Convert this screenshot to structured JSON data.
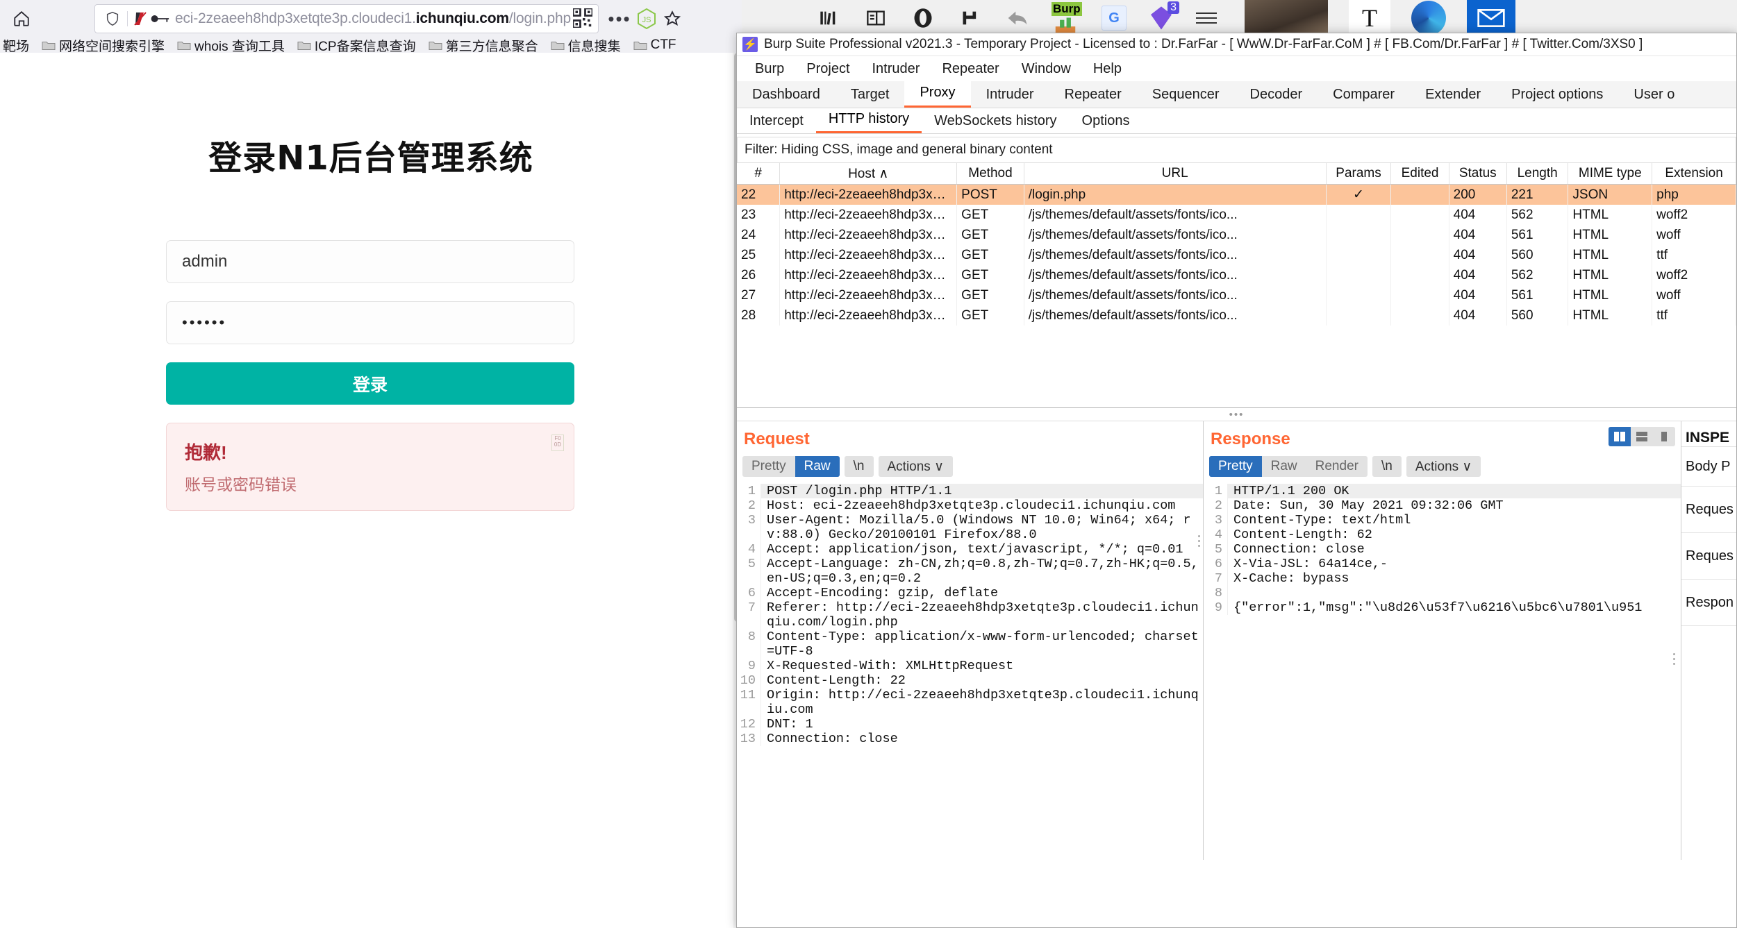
{
  "browser": {
    "url_prefix": "eci-2zeaeeh8hdp3xetqte3p.cloudeci1.",
    "url_domain": "ichunqiu.com",
    "url_path": "/login.php",
    "icons": {
      "home": "home-icon",
      "shield": "shield-icon",
      "noscript": "noscript-icon",
      "key": "key-icon",
      "qr": "qr-code-icon",
      "more": "more-dots-icon",
      "js": "js-badge-icon",
      "pocket": "pocket-star-icon"
    },
    "bookmarks": [
      {
        "label": "靶场",
        "icon": "folder-icon"
      },
      {
        "label": "网络空间搜索引擎",
        "icon": "folder-icon"
      },
      {
        "label": "whois 查询工具",
        "icon": "folder-icon"
      },
      {
        "label": "ICP备案信息查询",
        "icon": "folder-icon"
      },
      {
        "label": "第三方信息聚合",
        "icon": "folder-icon"
      },
      {
        "label": "信息搜集",
        "icon": "folder-icon"
      },
      {
        "label": "CTF",
        "icon": "folder-icon"
      }
    ]
  },
  "login_page": {
    "title": "登录N1后台管理系统",
    "username_value": "admin",
    "password_value": "••••••",
    "submit_label": "登录",
    "alert_title": "抱歉!",
    "alert_message": "账号或密码错误",
    "accent_color": "#00b3a4",
    "alert_bg": "#fdf0f0",
    "alert_color": "#b02a37"
  },
  "burp": {
    "title": "Burp Suite Professional v2021.3 - Temporary Project - Licensed to : Dr.FarFar - [ WwW.Dr-FarFar.CoM ] # [ FB.Com/Dr.FarFar ] # [ Twitter.Com/3XS0 ]",
    "menu": [
      "Burp",
      "Project",
      "Intruder",
      "Repeater",
      "Window",
      "Help"
    ],
    "tabs": [
      {
        "label": "Dashboard",
        "selected": false
      },
      {
        "label": "Target",
        "selected": false
      },
      {
        "label": "Proxy",
        "selected": true
      },
      {
        "label": "Intruder",
        "selected": false
      },
      {
        "label": "Repeater",
        "selected": false
      },
      {
        "label": "Sequencer",
        "selected": false
      },
      {
        "label": "Decoder",
        "selected": false
      },
      {
        "label": "Comparer",
        "selected": false
      },
      {
        "label": "Extender",
        "selected": false
      },
      {
        "label": "Project options",
        "selected": false
      },
      {
        "label": "User o",
        "selected": false
      }
    ],
    "subtabs": [
      {
        "label": "Intercept",
        "selected": false
      },
      {
        "label": "HTTP history",
        "selected": true
      },
      {
        "label": "WebSockets history",
        "selected": false
      },
      {
        "label": "Options",
        "selected": false
      }
    ],
    "filter": "Filter: Hiding CSS, image and general binary content",
    "accent_color": "#ff6633",
    "selected_row_color": "#fcc49a",
    "table": {
      "columns": [
        "#",
        "Host ∧",
        "Method",
        "URL",
        "Params",
        "Edited",
        "Status",
        "Length",
        "MIME type",
        "Extension"
      ],
      "rows": [
        {
          "id": "22",
          "host": "http://eci-2zeaeeh8hdp3xet...",
          "method": "POST",
          "url": "/login.php",
          "params": "✓",
          "edited": "",
          "status": "200",
          "length": "221",
          "mime": "JSON",
          "ext": "php",
          "selected": true
        },
        {
          "id": "23",
          "host": "http://eci-2zeaeeh8hdp3xet...",
          "method": "GET",
          "url": "/js/themes/default/assets/fonts/ico...",
          "params": "",
          "edited": "",
          "status": "404",
          "length": "562",
          "mime": "HTML",
          "ext": "woff2",
          "selected": false
        },
        {
          "id": "24",
          "host": "http://eci-2zeaeeh8hdp3xet...",
          "method": "GET",
          "url": "/js/themes/default/assets/fonts/ico...",
          "params": "",
          "edited": "",
          "status": "404",
          "length": "561",
          "mime": "HTML",
          "ext": "woff",
          "selected": false
        },
        {
          "id": "25",
          "host": "http://eci-2zeaeeh8hdp3xet...",
          "method": "GET",
          "url": "/js/themes/default/assets/fonts/ico...",
          "params": "",
          "edited": "",
          "status": "404",
          "length": "560",
          "mime": "HTML",
          "ext": "ttf",
          "selected": false
        },
        {
          "id": "26",
          "host": "http://eci-2zeaeeh8hdp3xet...",
          "method": "GET",
          "url": "/js/themes/default/assets/fonts/ico...",
          "params": "",
          "edited": "",
          "status": "404",
          "length": "562",
          "mime": "HTML",
          "ext": "woff2",
          "selected": false
        },
        {
          "id": "27",
          "host": "http://eci-2zeaeeh8hdp3xet...",
          "method": "GET",
          "url": "/js/themes/default/assets/fonts/ico...",
          "params": "",
          "edited": "",
          "status": "404",
          "length": "561",
          "mime": "HTML",
          "ext": "woff",
          "selected": false
        },
        {
          "id": "28",
          "host": "http://eci-2zeaeeh8hdp3xet...",
          "method": "GET",
          "url": "/js/themes/default/assets/fonts/ico...",
          "params": "",
          "edited": "",
          "status": "404",
          "length": "560",
          "mime": "HTML",
          "ext": "ttf",
          "selected": false
        }
      ]
    },
    "request": {
      "header": "Request",
      "toggle": [
        {
          "label": "Pretty",
          "on": false
        },
        {
          "label": "Raw",
          "on": true
        }
      ],
      "newline_label": "\\n",
      "actions_label": "Actions ∨",
      "lines": [
        {
          "n": "1",
          "text": "POST /login.php HTTP/1.1",
          "hl": true
        },
        {
          "n": "2",
          "text": "Host: eci-2zeaeeh8hdp3xetqte3p.cloudeci1.ichunqiu.com"
        },
        {
          "n": "3",
          "text": "User-Agent: Mozilla/5.0 (Windows NT 10.0; Win64; x64; rv:88.0) Gecko/20100101 Firefox/88.0"
        },
        {
          "n": "4",
          "text": "Accept: application/json, text/javascript, */*; q=0.01"
        },
        {
          "n": "5",
          "text": "Accept-Language: zh-CN,zh;q=0.8,zh-TW;q=0.7,zh-HK;q=0.5,en-US;q=0.3,en;q=0.2"
        },
        {
          "n": "6",
          "text": "Accept-Encoding: gzip, deflate"
        },
        {
          "n": "7",
          "text": "Referer: http://eci-2zeaeeh8hdp3xetqte3p.cloudeci1.ichunqiu.com/login.php"
        },
        {
          "n": "8",
          "text": "Content-Type: application/x-www-form-urlencoded; charset=UTF-8"
        },
        {
          "n": "9",
          "text": "X-Requested-With: XMLHttpRequest"
        },
        {
          "n": "10",
          "text": "Content-Length: 22"
        },
        {
          "n": "11",
          "text": "Origin: http://eci-2zeaeeh8hdp3xetqte3p.cloudeci1.ichunqiu.com"
        },
        {
          "n": "12",
          "text": "DNT: 1"
        },
        {
          "n": "13",
          "text": "Connection: close"
        }
      ]
    },
    "response": {
      "header": "Response",
      "toggle": [
        {
          "label": "Pretty",
          "on": true
        },
        {
          "label": "Raw",
          "on": false
        },
        {
          "label": "Render",
          "on": false
        }
      ],
      "newline_label": "\\n",
      "actions_label": "Actions ∨",
      "lines": [
        {
          "n": "1",
          "text": "HTTP/1.1 200 OK",
          "hl": true
        },
        {
          "n": "2",
          "text": "Date: Sun, 30 May 2021 09:32:06 GMT"
        },
        {
          "n": "3",
          "text": "Content-Type: text/html"
        },
        {
          "n": "4",
          "text": "Content-Length: 62"
        },
        {
          "n": "5",
          "text": "Connection: close"
        },
        {
          "n": "6",
          "text": "X-Via-JSL: 64a14ce,-"
        },
        {
          "n": "7",
          "text": "X-Cache: bypass"
        },
        {
          "n": "8",
          "text": ""
        },
        {
          "n": "9",
          "text": "{\"error\":1,\"msg\":\"\\u8d26\\u53f7\\u6216\\u5bc6\\u7801\\u951"
        }
      ]
    },
    "inspector": {
      "title": "INSPE",
      "rows": [
        "Body P",
        "Reques",
        "Reques",
        "Respon"
      ]
    }
  }
}
